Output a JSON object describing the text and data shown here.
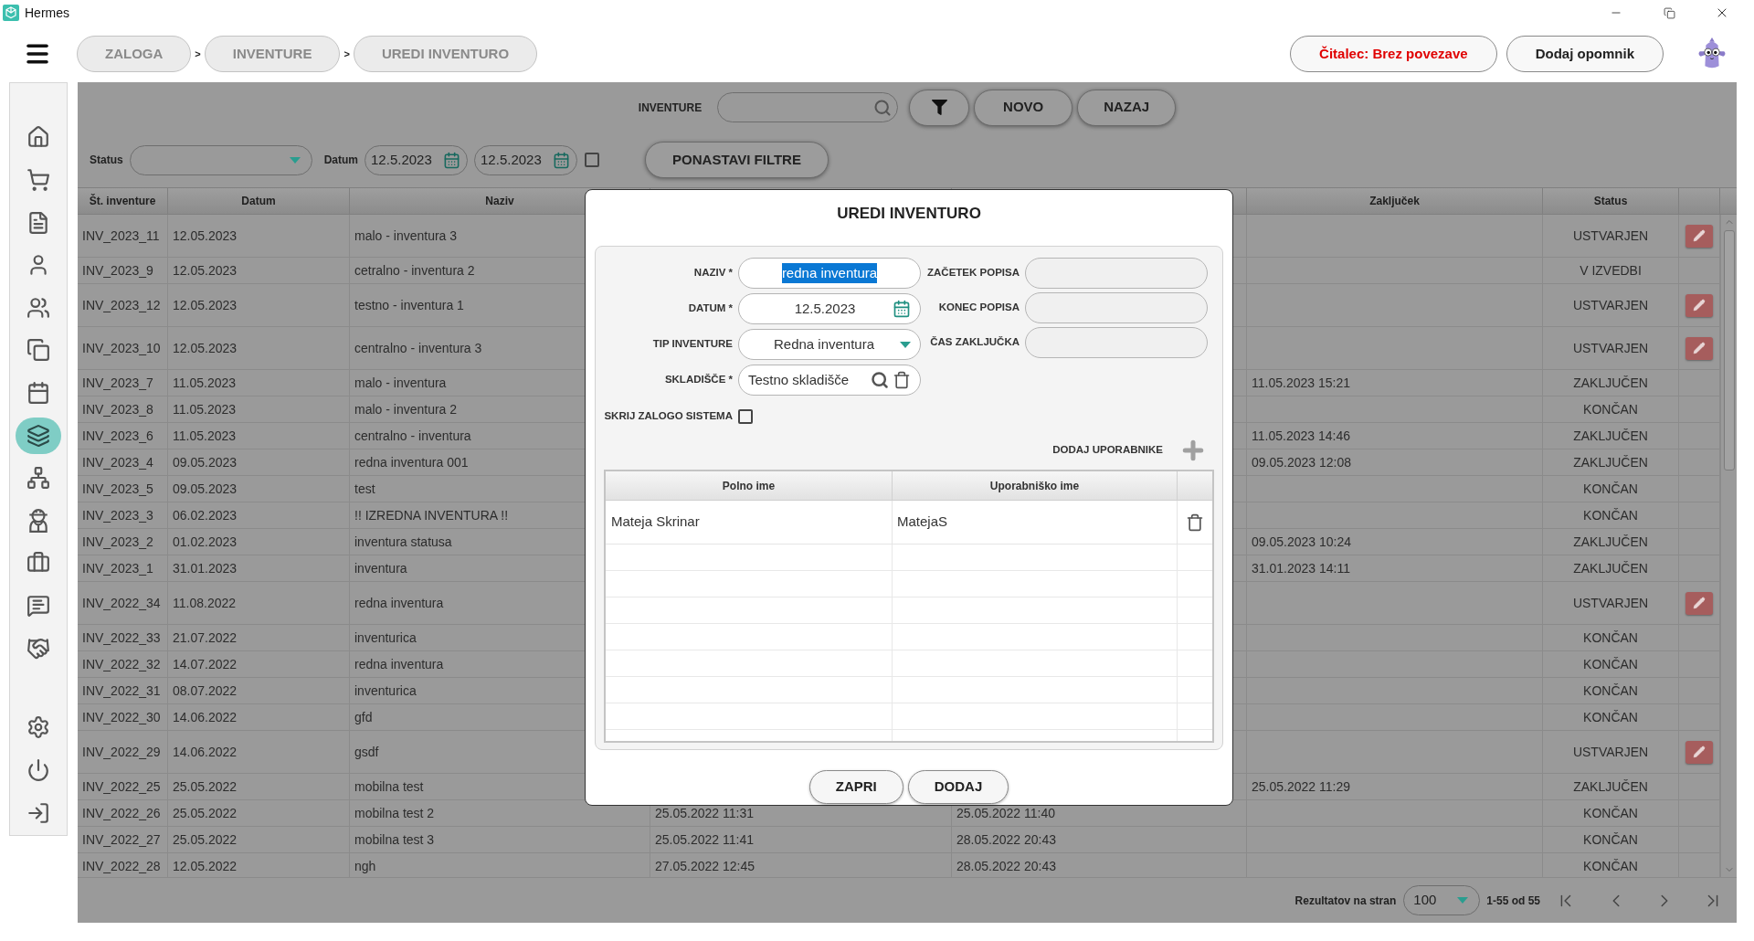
{
  "window": {
    "title": "Hermes"
  },
  "breadcrumbs": [
    {
      "label": "ZALOGA",
      "separator": ">"
    },
    {
      "label": "INVENTURE",
      "separator": ">"
    },
    {
      "label": "UREDI INVENTURO"
    }
  ],
  "header_buttons": [
    {
      "label": "Čitalec: Brez povezave",
      "kind": "warning"
    },
    {
      "label": "Dodaj opomnik",
      "kind": "normal"
    }
  ],
  "sidebar": {
    "items": [
      {
        "selected": false
      },
      {
        "selected": false
      },
      {
        "selected": false
      },
      {
        "selected": false
      },
      {
        "selected": false
      },
      {
        "selected": false
      },
      {
        "selected": false
      },
      {
        "selected": true
      },
      {
        "selected": false
      },
      {
        "selected": false
      },
      {
        "selected": false
      },
      {
        "selected": false
      },
      {
        "selected": false
      }
    ],
    "bottom_items": [
      {
        "selected": false
      },
      {
        "selected": false
      },
      {
        "selected": false
      }
    ]
  },
  "toolbar": {
    "search_label": "INVENTURE",
    "buttons": [
      "NOVO",
      "NAZAJ"
    ]
  },
  "filters": {
    "status_label": "Status",
    "date_label": "Datum",
    "date_from": "12.5.2023",
    "date_to": "12.5.2023",
    "date_checkbox": {
      "checked": false
    },
    "reset_button": "PONASTAVI FILTRE"
  },
  "table": {
    "columns": {
      "number": "Št. inventure",
      "date": "Datum",
      "name": "Naziv",
      "closing": "Zaključek",
      "status": "Status"
    },
    "rows": [
      {
        "number": "INV_2023_11",
        "date": "12.05.2023",
        "name": "malo - inventura 3",
        "status": "USTVARJEN",
        "editable": true
      },
      {
        "number": "INV_2023_9",
        "date": "12.05.2023",
        "name": "cetralno - inventura 2",
        "status": "V IZVEDBI",
        "editable": false
      },
      {
        "number": "INV_2023_12",
        "date": "12.05.2023",
        "name": "testno - inventura 1",
        "status": "USTVARJEN",
        "editable": true
      },
      {
        "number": "INV_2023_10",
        "date": "12.05.2023",
        "name": "centralno - inventura 3",
        "status": "USTVARJEN",
        "editable": true
      },
      {
        "number": "INV_2023_7",
        "date": "11.05.2023",
        "name": "malo - inventura",
        "closing": "11.05.2023 15:21",
        "status": "ZAKLJUČEN",
        "editable": false
      },
      {
        "number": "INV_2023_8",
        "date": "11.05.2023",
        "name": "malo - inventura 2",
        "status": "KONČAN",
        "editable": false
      },
      {
        "number": "INV_2023_6",
        "date": "11.05.2023",
        "name": "centralno - inventura",
        "closing": "11.05.2023 14:46",
        "status": "ZAKLJUČEN",
        "editable": false
      },
      {
        "number": "INV_2023_4",
        "date": "09.05.2023",
        "name": "redna inventura 001",
        "closing": "09.05.2023 12:08",
        "status": "ZAKLJUČEN",
        "editable": false
      },
      {
        "number": "INV_2023_5",
        "date": "09.05.2023",
        "name": "test",
        "status": "KONČAN",
        "editable": false
      },
      {
        "number": "INV_2023_3",
        "date": "06.02.2023",
        "name": "!! IZREDNA INVENTURA !!",
        "status": "KONČAN",
        "editable": false
      },
      {
        "number": "INV_2023_2",
        "date": "01.02.2023",
        "name": "inventura statusa",
        "closing": "09.05.2023 10:24",
        "status": "ZAKLJUČEN",
        "editable": false
      },
      {
        "number": "INV_2023_1",
        "date": "31.01.2023",
        "name": "inventura",
        "closing": "31.01.2023 14:11",
        "status": "ZAKLJUČEN",
        "editable": false
      },
      {
        "number": "INV_2022_34",
        "date": "11.08.2022",
        "name": "redna inventura",
        "status": "USTVARJEN",
        "editable": true
      },
      {
        "number": "INV_2022_33",
        "date": "21.07.2022",
        "name": "inventurica",
        "status": "KONČAN",
        "editable": false
      },
      {
        "number": "INV_2022_32",
        "date": "14.07.2022",
        "name": "redna inventura",
        "status": "KONČAN",
        "editable": false
      },
      {
        "number": "INV_2022_31",
        "date": "08.07.2022",
        "name": "inventurica",
        "status": "KONČAN",
        "editable": false
      },
      {
        "number": "INV_2022_30",
        "date": "14.06.2022",
        "name": "gfd",
        "status": "KONČAN",
        "editable": false
      },
      {
        "number": "INV_2022_29",
        "date": "14.06.2022",
        "name": "gsdf",
        "status": "USTVARJEN",
        "editable": true
      },
      {
        "number": "INV_2022_25",
        "date": "25.05.2022",
        "name": "mobilna test",
        "closing": "25.05.2022 11:29",
        "status": "ZAKLJUČEN",
        "editable": false
      },
      {
        "number": "INV_2022_26",
        "date": "25.05.2022",
        "name": "mobilna test 2",
        "column_4": "25.05.2022 11:31",
        "column_5": "25.05.2022 11:40",
        "status": "KONČAN",
        "editable": false
      },
      {
        "number": "INV_2022_27",
        "date": "25.05.2022",
        "name": "mobilna test 3",
        "column_4": "25.05.2022 11:41",
        "column_5": "28.05.2022 20:43",
        "status": "KONČAN",
        "editable": false
      },
      {
        "number": "INV_2022_28",
        "date": "12.05.2022",
        "name": "ngh",
        "column_4": "27.05.2022 12:45",
        "column_5": "28.05.2022 20:43",
        "status": "KONČAN",
        "editable": false
      }
    ]
  },
  "pagination": {
    "per_page_label": "Rezultatov na stran",
    "per_page": "100",
    "range": "1-55 od 55"
  },
  "modal": {
    "title": "UREDI INVENTURO",
    "fields": [
      {
        "label": "NAZIV *",
        "value": "redna inventura",
        "kind": "text",
        "text_selected": true,
        "disabled": false
      },
      {
        "label": "DATUM *",
        "value": "12.5.2023",
        "kind": "date",
        "text_selected": false,
        "disabled": false
      },
      {
        "label": "TIP INVENTURE",
        "value": "Redna inventura",
        "kind": "select",
        "text_selected": false,
        "disabled": false
      },
      {
        "label": "SKLADIŠČE *",
        "value": "Testno skladišče",
        "kind": "lookup",
        "text_selected": false,
        "disabled": false
      }
    ],
    "time_fields": [
      {
        "label": "ZAČETEK POPISA",
        "disabled": true
      },
      {
        "label": "KONEC POPISA",
        "disabled": true
      },
      {
        "label": "ČAS ZAKLJUČKA",
        "disabled": true
      }
    ],
    "hide_system_stock": {
      "label": "SKRIJ ZALOGO SISTEMA",
      "checked": false
    },
    "add_users_label": "DODAJ UPORABNIKE",
    "users": {
      "columns": [
        "Polno ime",
        "Uporabniško ime"
      ],
      "rows": [
        {
          "full_name": "Mateja Skrinar",
          "username": "MatejaS"
        }
      ]
    },
    "buttons": [
      "ZAPRI",
      "DODAJ"
    ]
  }
}
